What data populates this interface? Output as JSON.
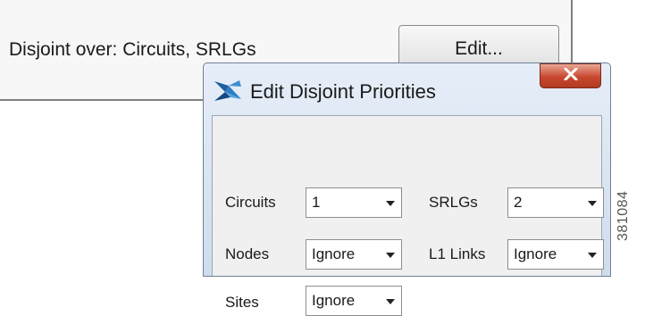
{
  "background": {
    "disjoint_text": "Disjoint over: Circuits, SRLGs",
    "edit_button_label": "Edit..."
  },
  "dialog": {
    "title": "Edit Disjoint Priorities",
    "app_icon": "cisco-wae-icon",
    "close_icon": "close-icon",
    "title_colors": {
      "close_button": "#c8482f",
      "frame": "#cfdcec"
    },
    "fields": {
      "circuits": {
        "label": "Circuits",
        "value": "1"
      },
      "srlgs": {
        "label": "SRLGs",
        "value": "2"
      },
      "nodes": {
        "label": "Nodes",
        "value": "Ignore"
      },
      "l1_links": {
        "label": "L1 Links",
        "value": "Ignore"
      },
      "sites": {
        "label": "Sites",
        "value": "Ignore"
      }
    }
  },
  "figure_id": "381084"
}
